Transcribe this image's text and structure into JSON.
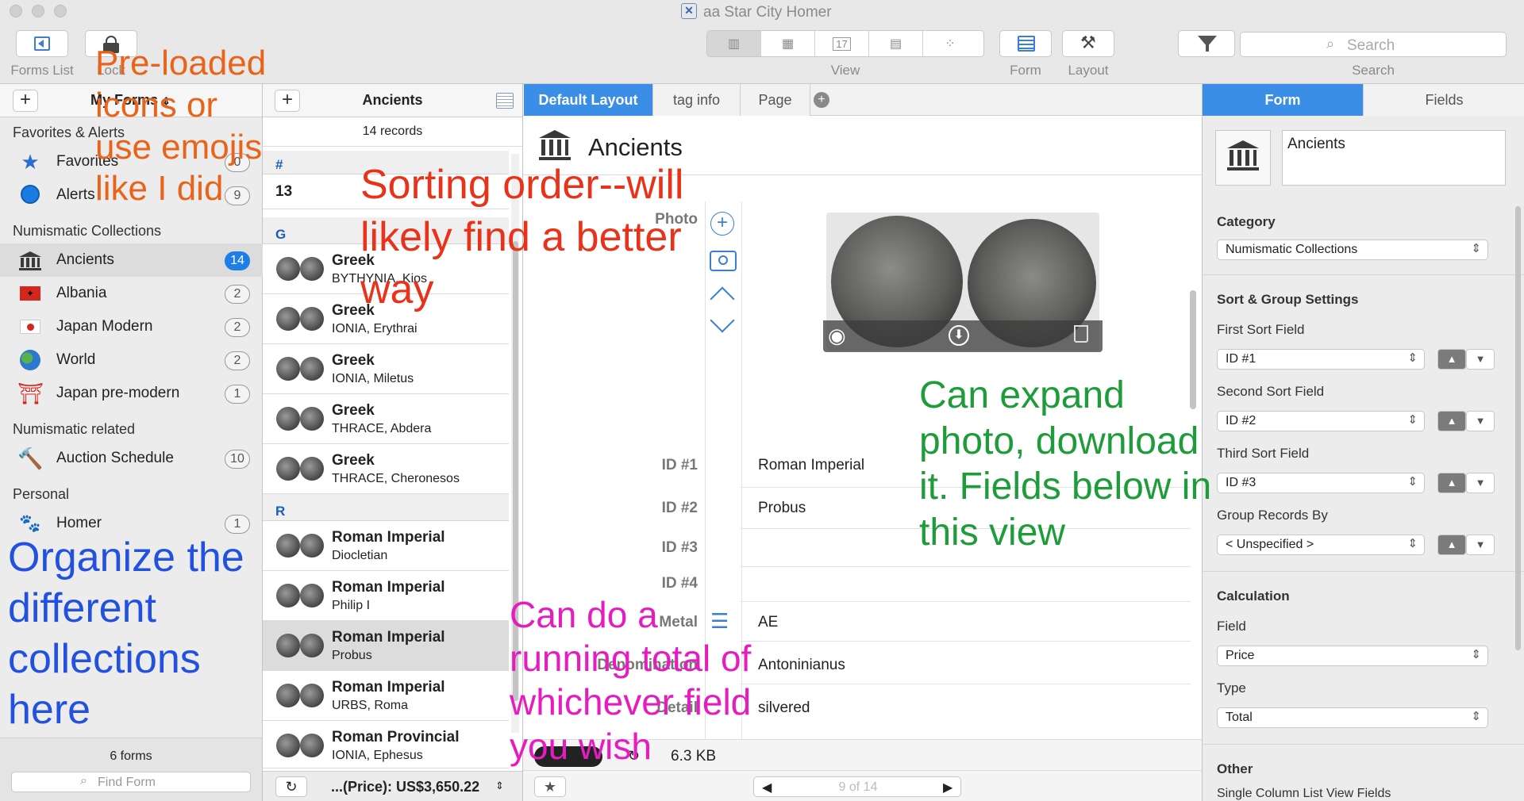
{
  "window": {
    "title": "aa Star City Homer"
  },
  "toolbar": {
    "forms_list": "Forms List",
    "lock": "Lock",
    "view": "View",
    "calendar_day": "17",
    "form": "Form",
    "layout": "Layout",
    "search_placeholder": "Search",
    "search_label": "Search"
  },
  "sidebar": {
    "title": "My Forms",
    "sections": {
      "favorites_alerts": "Favorites & Alerts",
      "numismatic_collections": "Numismatic Collections",
      "numismatic_related": "Numismatic related",
      "personal": "Personal"
    },
    "items": [
      {
        "label": "Favorites",
        "count": "0",
        "icon": "star-icon"
      },
      {
        "label": "Alerts",
        "count": "9",
        "icon": "alarm-clock-icon"
      },
      {
        "label": "Ancients",
        "count": "14",
        "icon": "temple-icon"
      },
      {
        "label": "Albania",
        "count": "2",
        "icon": "albania-flag-icon"
      },
      {
        "label": "Japan Modern",
        "count": "2",
        "icon": "japan-flag-icon"
      },
      {
        "label": "World",
        "count": "2",
        "icon": "globe-icon"
      },
      {
        "label": "Japan pre-modern",
        "count": "1",
        "icon": "torii-icon"
      },
      {
        "label": "Auction Schedule",
        "count": "10",
        "icon": "gavel-icon"
      },
      {
        "label": "Homer",
        "count": "1",
        "icon": "paw-icon"
      }
    ],
    "footer_count": "6 forms",
    "find_placeholder": "Find Form"
  },
  "list": {
    "title": "Ancients",
    "records": "14 records",
    "group_hash": "#",
    "row_13": "13",
    "group_g": "G",
    "group_r": "R",
    "rows": [
      {
        "title": "Greek",
        "sub": "BYTHYNIA, Kios"
      },
      {
        "title": "Greek",
        "sub": "IONIA, Erythrai"
      },
      {
        "title": "Greek",
        "sub": "IONIA, Miletus"
      },
      {
        "title": "Greek",
        "sub": "THRACE, Abdera"
      },
      {
        "title": "Greek",
        "sub": "THRACE, Cheronesos"
      },
      {
        "title": "Roman Imperial",
        "sub": "Diocletian"
      },
      {
        "title": "Roman Imperial",
        "sub": "Philip I"
      },
      {
        "title": "Roman Imperial",
        "sub": "Probus"
      },
      {
        "title": "Roman Imperial",
        "sub": "URBS, Roma"
      },
      {
        "title": "Roman Provincial",
        "sub": "IONIA, Ephesus"
      }
    ],
    "footer_total": "...(Price): US$3,650.22"
  },
  "detail": {
    "tabs": [
      "Default Layout",
      "tag info",
      "Page"
    ],
    "form_title": "Ancients",
    "fields": [
      {
        "label": "Photo",
        "value": ""
      },
      {
        "label": "ID #1",
        "value": "Roman Imperial"
      },
      {
        "label": "ID #2",
        "value": "Probus"
      },
      {
        "label": "ID #3",
        "value": ""
      },
      {
        "label": "ID #4",
        "value": ""
      },
      {
        "label": "Metal",
        "value": "AE"
      },
      {
        "label": "Denomination",
        "value": "Antoninianus"
      },
      {
        "label": "Detail",
        "value": "silvered"
      }
    ],
    "file_size": "6.3 KB",
    "pager": "9 of 14"
  },
  "inspector": {
    "tabs": [
      "Form",
      "Fields"
    ],
    "form_name": "Ancients",
    "category_label": "Category",
    "category_value": "Numismatic Collections",
    "sort_heading": "Sort & Group Settings",
    "first_sort_label": "First Sort Field",
    "first_sort_value": "ID #1",
    "second_sort_label": "Second Sort Field",
    "second_sort_value": "ID #2",
    "third_sort_label": "Third Sort Field",
    "third_sort_value": "ID #3",
    "group_label": "Group Records By",
    "group_value": "< Unspecified >",
    "calc_heading": "Calculation",
    "field_label": "Field",
    "field_value": "Price",
    "type_label": "Type",
    "type_value": "Total",
    "other_heading": "Other",
    "single_column": "Single Column List View Fields"
  },
  "annotations": {
    "preloaded": [
      "Pre-loaded",
      "icons or",
      "use emojis",
      "like I did"
    ],
    "sorting": [
      "Sorting order--will",
      "likely find a better",
      "way"
    ],
    "expand": [
      "Can expand",
      "photo, download",
      "it. Fields below in",
      "this view"
    ],
    "organize": [
      "Organize the",
      "different",
      "collections",
      "here"
    ],
    "running": [
      "Can do a",
      "running total of",
      "whichever field",
      "you wish"
    ]
  }
}
